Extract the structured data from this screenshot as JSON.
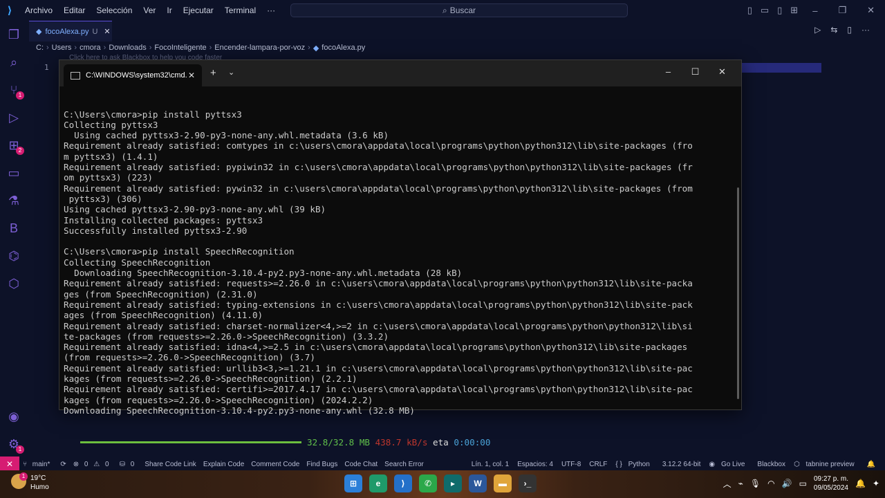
{
  "titlebar": {
    "menu": [
      "Archivo",
      "Editar",
      "Selección",
      "Ver",
      "Ir",
      "Ejecutar",
      "Terminal",
      "···"
    ],
    "search_label": "Buscar"
  },
  "activity_badges": {
    "source_control": "1",
    "extensions": "2",
    "accounts": "1"
  },
  "editor": {
    "tab_label": "focoAlexa.py",
    "tab_status": "U",
    "breadcrumb": [
      "C:",
      "Users",
      "cmora",
      "Downloads",
      "FocoInteligente",
      "Encender-lampara-por-voz",
      "focoAlexa.py"
    ],
    "blackbox_hint": "Click here to ask Blackbox to help you code faster",
    "line_number": "1"
  },
  "cmd": {
    "tab_title": "C:\\WINDOWS\\system32\\cmd.",
    "lines": [
      "C:\\Users\\cmora>pip install pyttsx3",
      "Collecting pyttsx3",
      "  Using cached pyttsx3-2.90-py3-none-any.whl.metadata (3.6 kB)",
      "Requirement already satisfied: comtypes in c:\\users\\cmora\\appdata\\local\\programs\\python\\python312\\lib\\site-packages (fro",
      "m pyttsx3) (1.4.1)",
      "Requirement already satisfied: pypiwin32 in c:\\users\\cmora\\appdata\\local\\programs\\python\\python312\\lib\\site-packages (fr",
      "om pyttsx3) (223)",
      "Requirement already satisfied: pywin32 in c:\\users\\cmora\\appdata\\local\\programs\\python\\python312\\lib\\site-packages (from",
      " pyttsx3) (306)",
      "Using cached pyttsx3-2.90-py3-none-any.whl (39 kB)",
      "Installing collected packages: pyttsx3",
      "Successfully installed pyttsx3-2.90",
      "",
      "C:\\Users\\cmora>pip install SpeechRecognition",
      "Collecting SpeechRecognition",
      "  Downloading SpeechRecognition-3.10.4-py2.py3-none-any.whl.metadata (28 kB)",
      "Requirement already satisfied: requests>=2.26.0 in c:\\users\\cmora\\appdata\\local\\programs\\python\\python312\\lib\\site-packa",
      "ges (from SpeechRecognition) (2.31.0)",
      "Requirement already satisfied: typing-extensions in c:\\users\\cmora\\appdata\\local\\programs\\python\\python312\\lib\\site-pack",
      "ages (from SpeechRecognition) (4.11.0)",
      "Requirement already satisfied: charset-normalizer<4,>=2 in c:\\users\\cmora\\appdata\\local\\programs\\python\\python312\\lib\\si",
      "te-packages (from requests>=2.26.0->SpeechRecognition) (3.3.2)",
      "Requirement already satisfied: idna<4,>=2.5 in c:\\users\\cmora\\appdata\\local\\programs\\python\\python312\\lib\\site-packages",
      "(from requests>=2.26.0->SpeechRecognition) (3.7)",
      "Requirement already satisfied: urllib3<3,>=1.21.1 in c:\\users\\cmora\\appdata\\local\\programs\\python\\python312\\lib\\site-pac",
      "kages (from requests>=2.26.0->SpeechRecognition) (2.2.1)",
      "Requirement already satisfied: certifi>=2017.4.17 in c:\\users\\cmora\\appdata\\local\\programs\\python\\python312\\lib\\site-pac",
      "kages (from requests>=2.26.0->SpeechRecognition) (2024.2.2)",
      "Downloading SpeechRecognition-3.10.4-py2.py3-none-any.whl (32.8 MB)"
    ],
    "progress": {
      "fraction": 1.0,
      "size": "32.8/32.8 MB",
      "speed": "438.7 kB/s",
      "eta_label": "eta",
      "eta": "0:00:00",
      "bar_color": "#6cbf3e"
    }
  },
  "statusbar": {
    "branch": "main*",
    "errors": "0",
    "warnings": "0",
    "ports": "0",
    "left_items": [
      "Share Code Link",
      "Explain Code",
      "Comment Code",
      "Find Bugs",
      "Code Chat",
      "Search Error"
    ],
    "position": "Lín. 1, col. 1",
    "spaces": "Espacios: 4",
    "encoding": "UTF-8",
    "eol": "CRLF",
    "language": "Python",
    "interpreter": "3.12.2 64-bit",
    "golive": "Go Live",
    "blackbox": "Blackbox",
    "tabnine": "tabnine preview"
  },
  "taskbar": {
    "weather_temp": "19°C",
    "weather_desc": "Humo",
    "weather_badge": "1",
    "time": "09:27 p. m.",
    "date": "09/05/2024"
  },
  "colors": {
    "accent": "#d61c72",
    "vscode_bg": "#0d1228",
    "terminal_bg": "#0c0c0c",
    "progress_green": "#60c04a",
    "speed_red": "#c0362c",
    "eta_cyan": "#4aa3d8"
  }
}
